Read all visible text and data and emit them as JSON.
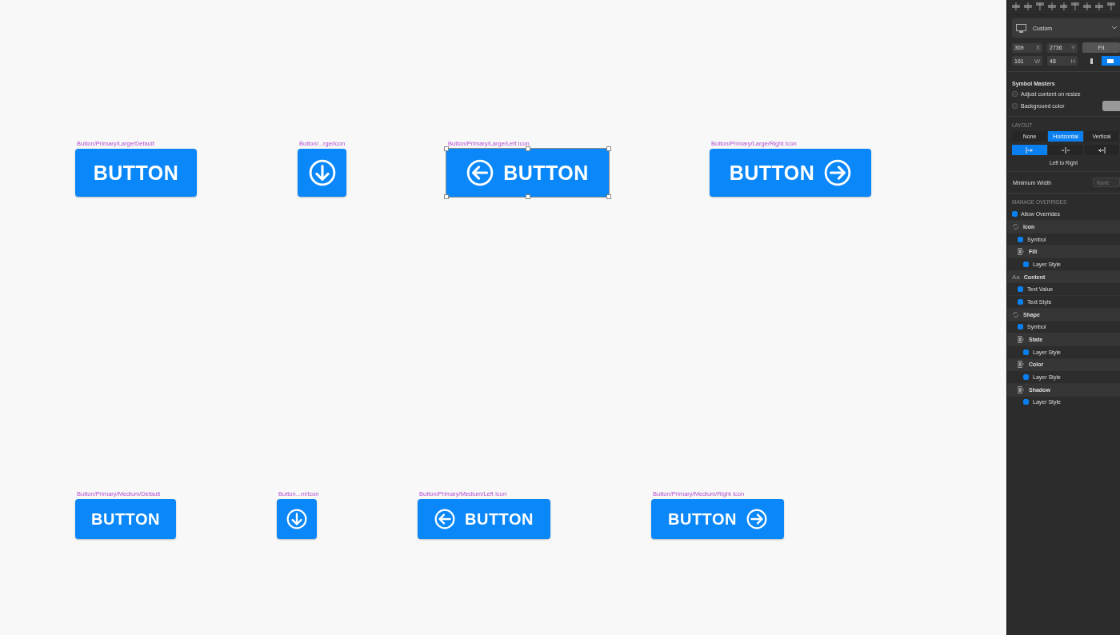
{
  "canvas": {
    "rows": [
      {
        "symbols": [
          {
            "label": "Button/Primary/Large/Default",
            "kind": "text",
            "text": "BUTTON",
            "selected": false
          },
          {
            "label": "Button/...rge/Icon",
            "kind": "icon",
            "selected": false
          },
          {
            "label": "Button/Primary/Large/Left Icon",
            "kind": "left_icon",
            "text": "BUTTON",
            "selected": true
          },
          {
            "label": "Button/Primary/Large/Right Icon",
            "kind": "right_icon",
            "text": "BUTTON",
            "selected": false
          }
        ]
      },
      {
        "symbols": [
          {
            "label": "Button/Primary/Medium/Default",
            "kind": "text",
            "text": "BUTTON",
            "selected": false
          },
          {
            "label": "Button...m/Icon",
            "kind": "icon",
            "selected": false
          },
          {
            "label": "Button/Primary/Medium/Left Icon",
            "kind": "left_icon",
            "text": "BUTTON",
            "selected": false
          },
          {
            "label": "Button/Primary/Medium/Right Icon",
            "kind": "right_icon",
            "text": "BUTTON",
            "selected": false
          }
        ]
      }
    ]
  },
  "inspector": {
    "preset": "Custom",
    "x": {
      "value": "369",
      "label": "X"
    },
    "y": {
      "value": "2736",
      "label": "Y"
    },
    "fit_button": "Fit",
    "w": {
      "value": "161",
      "label": "W"
    },
    "h": {
      "value": "48",
      "label": "H"
    },
    "orientation": [
      {
        "kind": "portrait",
        "selected": false
      },
      {
        "kind": "landscape",
        "selected": true
      }
    ],
    "symbol_masters": {
      "title": "Symbol Masters",
      "options": [
        {
          "label": "Adjust content on resize",
          "checked": false
        },
        {
          "label": "Background color",
          "checked": false
        }
      ]
    },
    "layout": {
      "title": "LAYOUT",
      "modes": [
        {
          "label": "None",
          "selected": false
        },
        {
          "label": "Horizontal",
          "selected": true
        },
        {
          "label": "Vertical",
          "selected": false
        }
      ],
      "directions": [
        {
          "kind": "left",
          "selected": true
        },
        {
          "kind": "center",
          "selected": false
        },
        {
          "kind": "right",
          "selected": false
        }
      ],
      "direction_caption": "Left to Right",
      "min_width_label": "Minimum Width",
      "min_width_placeholder": "None"
    },
    "overrides": {
      "title": "MANAGE OVERRIDES",
      "allow": {
        "label": "Allow Overrides",
        "checked": true
      },
      "groups": [
        {
          "label": "Icon",
          "kind": "symbol",
          "children": [
            {
              "label": "Symbol",
              "kind": "option",
              "checked": true
            },
            {
              "label": "Fill",
              "kind": "style",
              "children": [
                {
                  "label": "Layer Style",
                  "kind": "option",
                  "checked": true
                }
              ]
            }
          ]
        },
        {
          "label": "Content",
          "kind": "text",
          "icon": "Aa",
          "children": [
            {
              "label": "Text Value",
              "kind": "option",
              "checked": true
            },
            {
              "label": "Text Style",
              "kind": "option",
              "checked": true
            }
          ]
        },
        {
          "label": "Shape",
          "kind": "symbol",
          "children": [
            {
              "label": "Symbol",
              "kind": "option",
              "checked": true
            },
            {
              "label": "State",
              "kind": "style",
              "children": [
                {
                  "label": "Layer Style",
                  "kind": "option",
                  "checked": true
                }
              ]
            },
            {
              "label": "Color",
              "kind": "style",
              "children": [
                {
                  "label": "Layer Style",
                  "kind": "option",
                  "checked": true
                }
              ]
            },
            {
              "label": "Shadow",
              "kind": "style",
              "children": [
                {
                  "label": "Layer Style",
                  "kind": "option",
                  "checked": true
                }
              ]
            }
          ]
        }
      ]
    }
  }
}
